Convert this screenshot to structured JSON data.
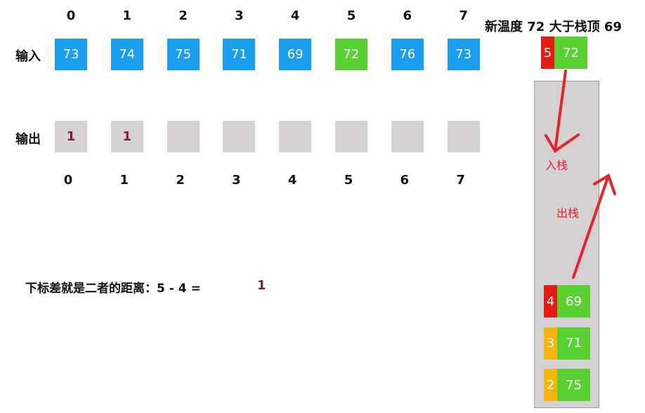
{
  "input_label": "输入",
  "output_label": "输出",
  "indices": [
    "0",
    "1",
    "2",
    "3",
    "4",
    "5",
    "6",
    "7"
  ],
  "input": [
    "73",
    "74",
    "75",
    "71",
    "69",
    "72",
    "76",
    "73"
  ],
  "highlight_index": 5,
  "output": [
    "1",
    "1",
    "",
    "",
    "",
    "",
    "",
    ""
  ],
  "header": "新温度 72 大于栈顶 69",
  "new_item": {
    "index": "5",
    "value": "72"
  },
  "push_label": "入栈",
  "pop_label": "出栈",
  "stack": [
    {
      "index": "4",
      "value": "69",
      "color": "red"
    },
    {
      "index": "3",
      "value": "71",
      "color": "orange"
    },
    {
      "index": "2",
      "value": "75",
      "color": "orange"
    }
  ],
  "formula": {
    "text": "下标差就是二者的距离：5 - 4 =",
    "result": "1"
  },
  "colors": {
    "blue": "#1a9ff0",
    "green": "#5ad132",
    "red": "#e41c13",
    "orange": "#f6b20d",
    "gray": "#d3d1d1",
    "arrow": "#e8222b",
    "result": "#7a1a4f"
  }
}
